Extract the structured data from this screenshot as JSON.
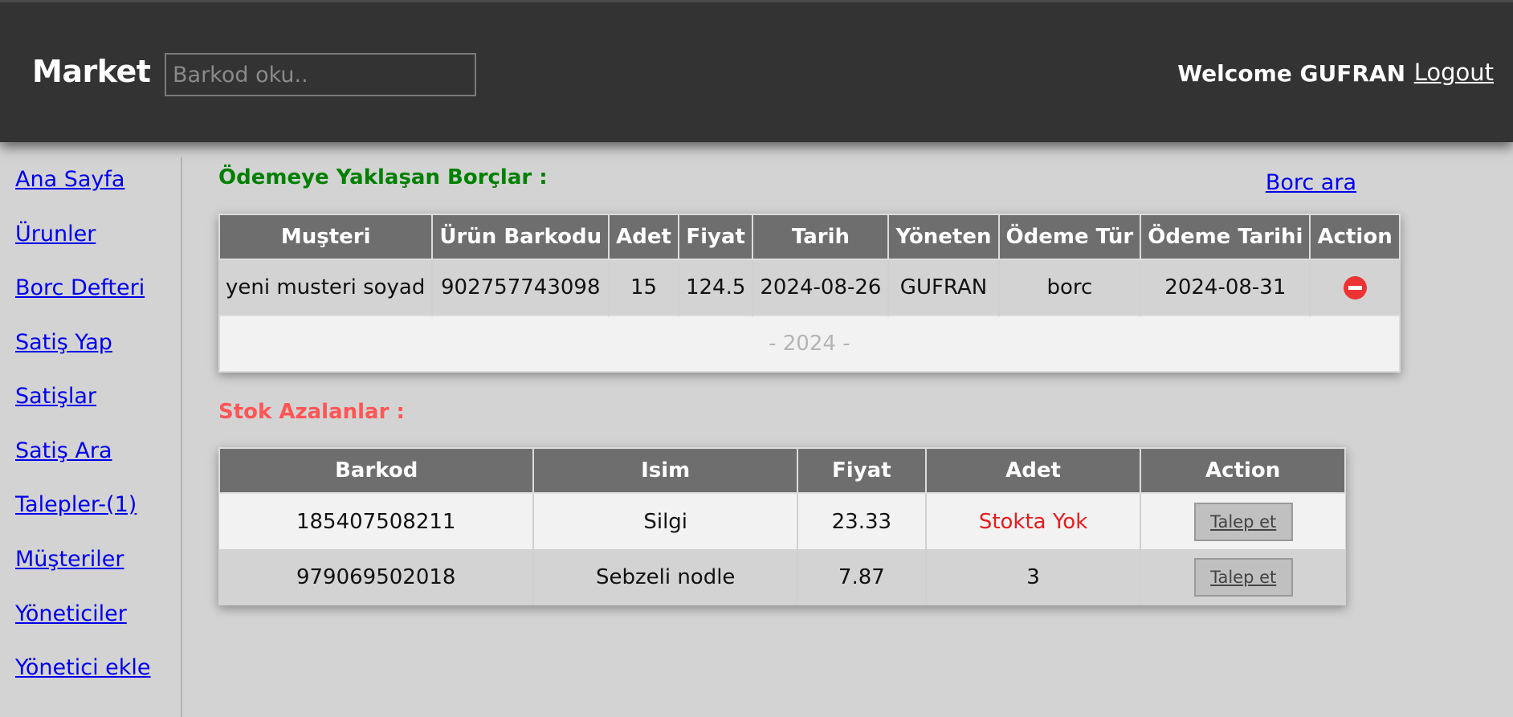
{
  "header": {
    "brand": "Market",
    "search_placeholder": "Barkod oku..",
    "welcome": "Welcome GUFRAN",
    "logout": "Logout"
  },
  "sidebar": {
    "items": [
      {
        "label": "Ana Sayfa"
      },
      {
        "label": "Ürunler"
      },
      {
        "label": "Borc Defteri"
      },
      {
        "label": "Satiş Yap"
      },
      {
        "label": "Satişlar"
      },
      {
        "label": "Satiş Ara"
      },
      {
        "label": "Talepler-(1)"
      },
      {
        "label": "Müşteriler"
      },
      {
        "label": "Yöneticiler"
      },
      {
        "label": "Yönetici ekle"
      }
    ]
  },
  "debts": {
    "title": "Ödemeye Yaklaşan Borçlar :",
    "search_link": "Borc ara",
    "columns": [
      "Muşteri",
      "Ürün Barkodu",
      "Adet",
      "Fiyat",
      "Tarih",
      "Yöneten",
      "Ödeme Tür",
      "Ödeme Tarihi",
      "Action"
    ],
    "rows": [
      {
        "customer": "yeni musteri soyad",
        "barcode": "902757743098",
        "qty": "15",
        "price": "124.5",
        "date": "2024-08-26",
        "manager": "GUFRAN",
        "payment_type": "borc",
        "payment_date": "2024-08-31",
        "action_icon": "remove-icon"
      }
    ],
    "year_row": "- 2024 -"
  },
  "low_stock": {
    "title": "Stok Azalanlar :",
    "columns": [
      "Barkod",
      "Isim",
      "Fiyat",
      "Adet",
      "Action"
    ],
    "rows": [
      {
        "barcode": "185407508211",
        "name": "Silgi",
        "price": "23.33",
        "qty": "Stokta Yok",
        "action": "Talep et"
      },
      {
        "barcode": "979069502018",
        "name": "Sebzeli nodle",
        "price": "7.87",
        "qty": "3",
        "action": "Talep et"
      }
    ]
  },
  "colors": {
    "header_bg": "#333333",
    "page_bg": "#d3d3d3",
    "debt_title": "#008000",
    "stock_title": "#ff5555",
    "table_header": "#6e6e6e",
    "link": "#0000ee",
    "danger": "#ee3333"
  }
}
